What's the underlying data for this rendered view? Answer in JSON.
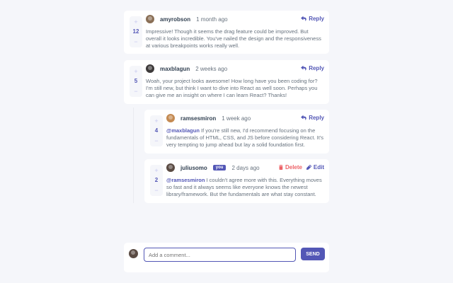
{
  "colors": {
    "accent": "#5357b6",
    "danger": "#ed6368",
    "background": "#f5f6fa"
  },
  "comments": [
    {
      "score": "12",
      "username": "amyrobson",
      "time": "1 month ago",
      "action": "Reply",
      "text": "Impressive! Though it seems the drag feature could be improved. But overall it looks incredible. You've nailed the design and the responsiveness at various breakpoints works really well.",
      "avatar_color": "#8a6f56"
    },
    {
      "score": "5",
      "username": "maxblagun",
      "time": "2 weeks ago",
      "action": "Reply",
      "text": "Woah, your project looks awesome! How long have you been coding for? I'm still new, but think I want to dive into React as well soon. Perhaps you can give me an insight on where I can learn React? Thanks!",
      "avatar_color": "#3d3a3a"
    }
  ],
  "replies": [
    {
      "score": "4",
      "username": "ramsesmiron",
      "time": "1 week ago",
      "action": "Reply",
      "mention": "@maxblagun",
      "text": "If you're still new, I'd recommend focusing on the fundamentals of HTML, CSS, and JS before considering React. It's very tempting to jump ahead but lay a solid foundation first.",
      "avatar_color": "#c48a52"
    },
    {
      "score": "2",
      "username": "juliusomo",
      "you_badge": "you",
      "time": "2 days ago",
      "delete_label": "Delete",
      "edit_label": "Edit",
      "mention": "@ramsesmiron",
      "text": "I couldn't agree more with this. Everything moves so fast and it always seems like everyone knows the newest library/framework. But the fundamentals are what stay constant.",
      "avatar_color": "#5a4b43"
    }
  ],
  "compose": {
    "placeholder": "Add a comment...",
    "send_label": "SEND",
    "avatar_color": "#5a4b43"
  },
  "vote": {
    "plus": "+",
    "minus": "−"
  }
}
